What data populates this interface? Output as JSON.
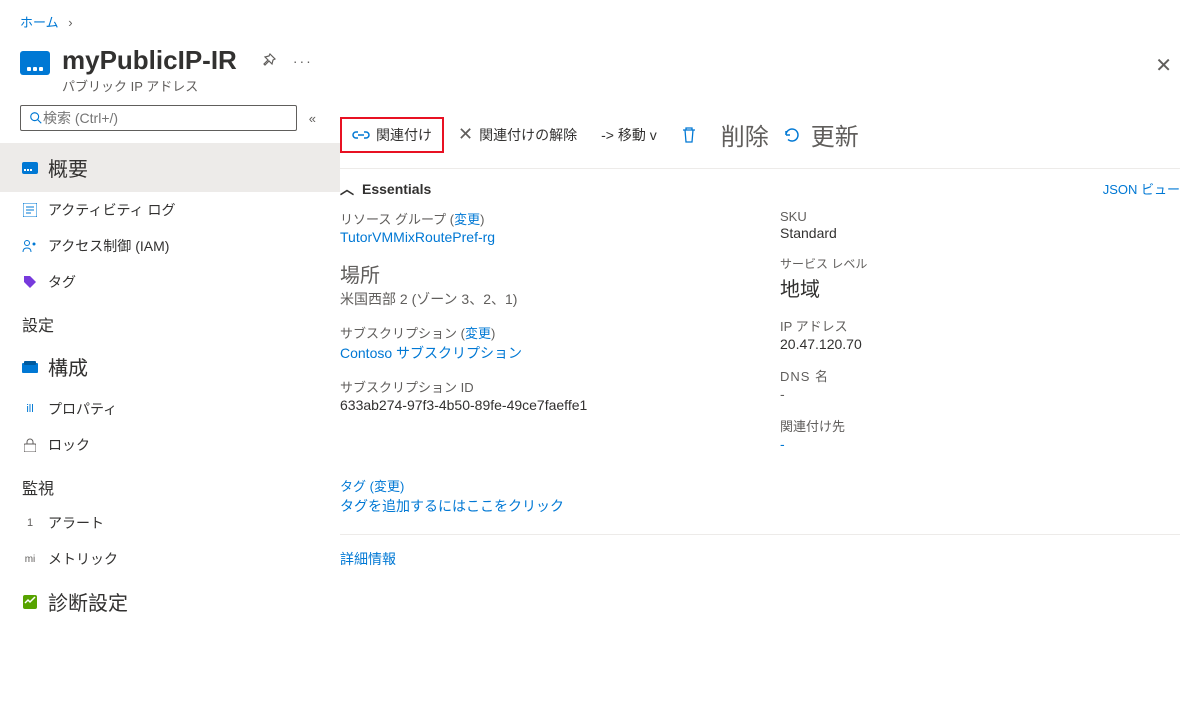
{
  "breadcrumb": {
    "home": "ホーム"
  },
  "header": {
    "title": "myPublicIP-IR",
    "subtitle": "パブリック IP アドレス"
  },
  "search": {
    "placeholder": "検索 (Ctrl+/)"
  },
  "nav": {
    "overview": "概要",
    "activity": "アクティビティ ログ",
    "iam": "アクセス制御 (IAM)",
    "tags": "タグ",
    "settings_header": "設定",
    "configuration": "構成",
    "properties": "プロパティ",
    "locks": "ロック",
    "monitor_header": "監視",
    "alerts": "アラート",
    "metrics": "メトリック",
    "diag": "診断設定"
  },
  "toolbar": {
    "associate": "関連付け",
    "dissociate": "関連付けの解除",
    "move": "-> 移動 v",
    "delete": "削除",
    "refresh": "更新"
  },
  "essentials": {
    "title": "Essentials",
    "json_view": "JSON ビュー",
    "left": {
      "rg_label": "リソース グループ (",
      "rg_change": "変更",
      "rg_close": ")",
      "rg_value": "TutorVMMixRoutePref-rg",
      "loc_label": "場所",
      "loc_value": "米国西部 2 (ゾーン 3、2、1)",
      "sub_label": "サブスクリプション (",
      "sub_change": "変更",
      "sub_close": ")",
      "sub_value": "Contoso サブスクリプション",
      "subid_label": "サブスクリプション ID",
      "subid_value": "633ab274-97f3-4b50-89fe-49ce7faeffe1"
    },
    "right": {
      "sku_label": "SKU",
      "sku_value": "Standard",
      "tier_label": "サービス レベル",
      "tier_value": "地域",
      "ip_label": "IP アドレス",
      "ip_value": "20.47.120.70",
      "dns_label": "DNS 名",
      "dns_value": "-",
      "assoc_label": "関連付け先",
      "assoc_value": "-"
    },
    "tags_label": "タグ (",
    "tags_change": "変更",
    "tags_close": ")",
    "tags_add": "タグを追加するにはここをクリック",
    "more_info": "詳細情報"
  }
}
